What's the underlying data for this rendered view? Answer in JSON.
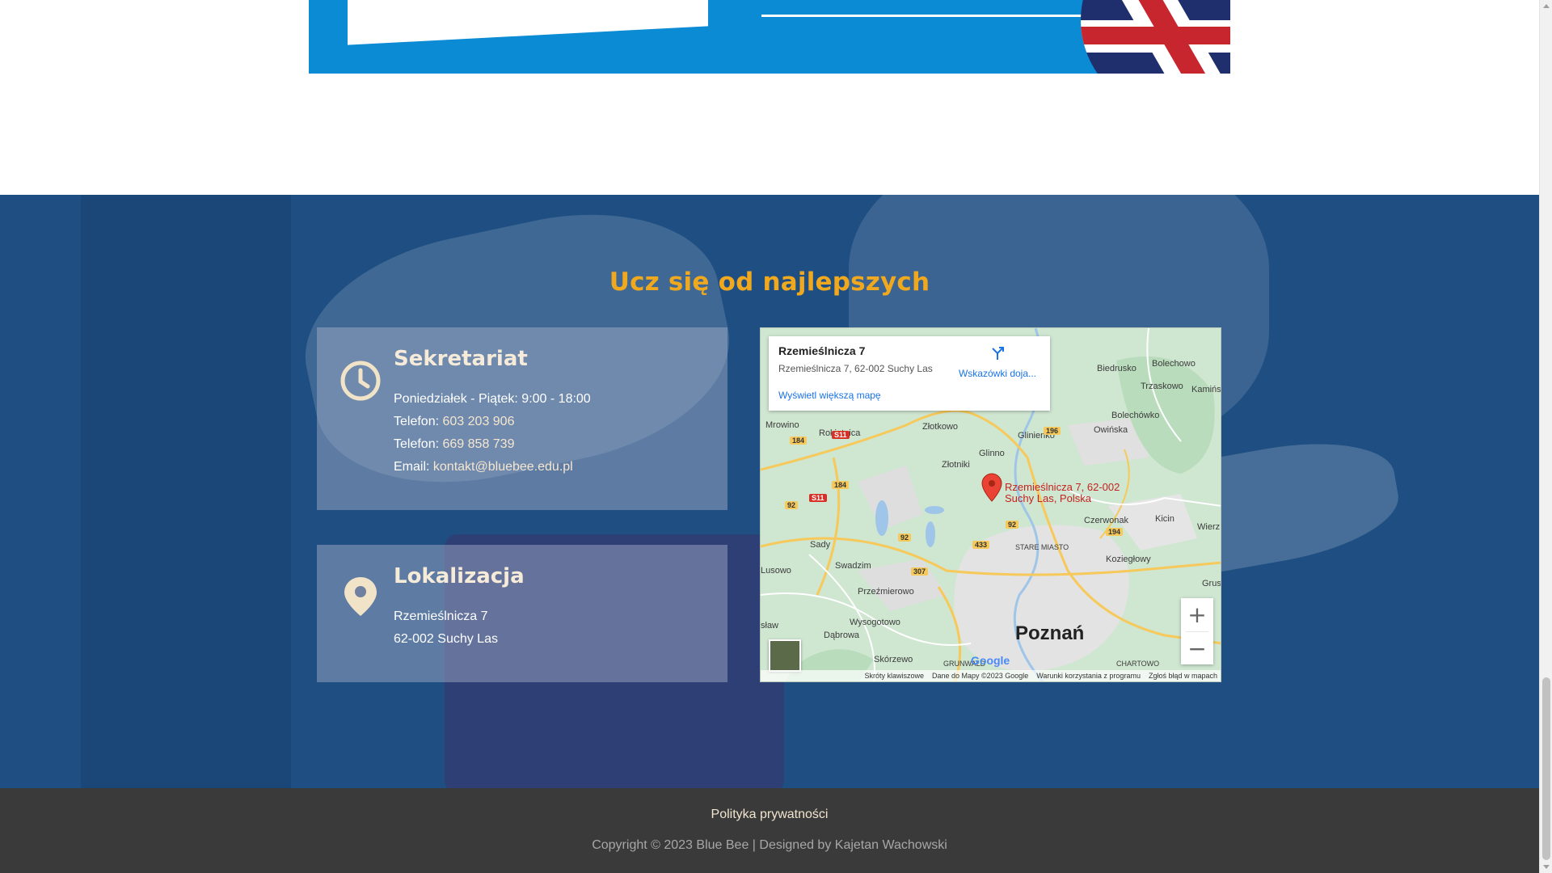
{
  "section": {
    "title": "Ucz się od najlepszych"
  },
  "secretariat": {
    "icon": "clock-icon",
    "heading": "Sekretariat",
    "hours": "Poniedziałek - Piątek: 9:00 - 18:00",
    "phone_label_1": "Telefon:",
    "phone_1": "603 203 906",
    "phone_label_2": "Telefon:",
    "phone_2": "669 858 739",
    "email_label": "Email:",
    "email": "kontakt@bluebee.edu.pl"
  },
  "location": {
    "icon": "map-pin-icon",
    "heading": "Lokalizacja",
    "street": "Rzemieślnicza 7",
    "city": "62-002 Suchy Las"
  },
  "map": {
    "info_title": "Rzemieślnicza 7",
    "info_address": "Rzemieślnicza 7, 62-002 Suchy Las",
    "directions_label": "Wskazówki doja...",
    "larger_map_label": "Wyświetl większą mapę",
    "pin_label_line1": "Rzemieślnicza 7, 62-002",
    "pin_label_line2": "Suchy Las, Polska",
    "city_label": "Poznań",
    "google_logo": "Google",
    "zoom_in": "+",
    "zoom_out": "−",
    "attribution": [
      "Skróty klawiszowe",
      "Dane do Mapy ©2023 Google",
      "Warunki korzystania z programu",
      "Zgłoś błąd w mapach"
    ],
    "places": [
      {
        "name": "Biedrusko"
      },
      {
        "name": "Bolechowo"
      },
      {
        "name": "Trzaskowo"
      },
      {
        "name": "Kamińsko"
      },
      {
        "name": "Bolechówko"
      },
      {
        "name": "Owińska"
      },
      {
        "name": "Mrowino"
      },
      {
        "name": "Rokietnica"
      },
      {
        "name": "Złotkowo"
      },
      {
        "name": "Glinienko"
      },
      {
        "name": "Glinno"
      },
      {
        "name": "Złotniki"
      },
      {
        "name": "Czerwonak"
      },
      {
        "name": "Kicin"
      },
      {
        "name": "STARE MIASTO"
      },
      {
        "name": "Koziegłowy"
      },
      {
        "name": "Sady"
      },
      {
        "name": "Swadzim"
      },
      {
        "name": "Lusowo"
      },
      {
        "name": "Przeźmierowo"
      },
      {
        "name": "Wysogotowo"
      },
      {
        "name": "Dąbrowa"
      },
      {
        "name": "Skórzewo"
      },
      {
        "name": "GRUNWALD"
      },
      {
        "name": "CHARTOWO"
      },
      {
        "name": "sław"
      },
      {
        "name": "Wierz"
      },
      {
        "name": "Grus"
      }
    ],
    "road_badges": [
      "184",
      "S11",
      "184",
      "S11",
      "92",
      "92",
      "92",
      "433",
      "307",
      "196",
      "194"
    ]
  },
  "footer": {
    "privacy": "Polityka prywatności",
    "copyright": "Copyright © 2023 Blue Bee | Designed by Kajetan Wachowski"
  },
  "colors": {
    "section_bg": "#1f4f82",
    "title_orange": "#f0a81e",
    "footer_bg": "#3a3a3a",
    "banner_blue": "#0a8bd3"
  }
}
